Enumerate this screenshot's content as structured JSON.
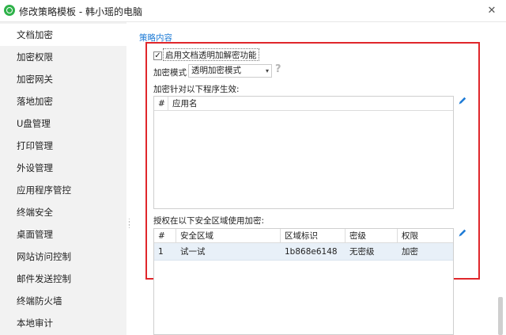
{
  "window": {
    "title": "修改策略模板 - 韩小瑶的电脑",
    "close_glyph": "✕"
  },
  "sidebar": {
    "items": [
      {
        "label": "文档加密",
        "active": true
      },
      {
        "label": "加密权限"
      },
      {
        "label": "加密网关"
      },
      {
        "label": "落地加密"
      },
      {
        "label": "U盘管理"
      },
      {
        "label": "打印管理"
      },
      {
        "label": "外设管理"
      },
      {
        "label": "应用程序管控"
      },
      {
        "label": "终端安全"
      },
      {
        "label": "桌面管理"
      },
      {
        "label": "网站访问控制"
      },
      {
        "label": "邮件发送控制"
      },
      {
        "label": "终端防火墙"
      },
      {
        "label": "本地审计"
      }
    ]
  },
  "content": {
    "section_title": "策略内容",
    "enable_checkbox": {
      "label": "启用文档透明加解密功能",
      "checked": true,
      "mark": "✓"
    },
    "mode": {
      "label": "加密模式",
      "value": "透明加密模式",
      "arrow": "▾",
      "help_glyph": "?"
    },
    "applies_label": "加密针对以下程序生效:",
    "app_table": {
      "columns": [
        "#",
        "应用名"
      ],
      "rows": []
    },
    "auth_label": "授权在以下安全区域使用加密:",
    "zone_table": {
      "columns": [
        "#",
        "安全区域",
        "区域标识",
        "密级",
        "权限"
      ],
      "rows": [
        {
          "index": "1",
          "zone": "试一试",
          "id": "1b868e6148",
          "level": "无密级",
          "permission": "加密"
        }
      ]
    }
  },
  "colors": {
    "accent_blue": "#1e7bd6",
    "highlight_red": "#e0262b",
    "selected_row": "#e8f0f8",
    "sidebar_bg": "#f2f2f2",
    "app_icon_green": "#2fb24a"
  },
  "icons": [
    "app-logo-icon",
    "close-icon",
    "chevron-down-icon",
    "help-icon",
    "pencil-icon",
    "checkmark-icon",
    "splitter-grip-icon"
  ]
}
